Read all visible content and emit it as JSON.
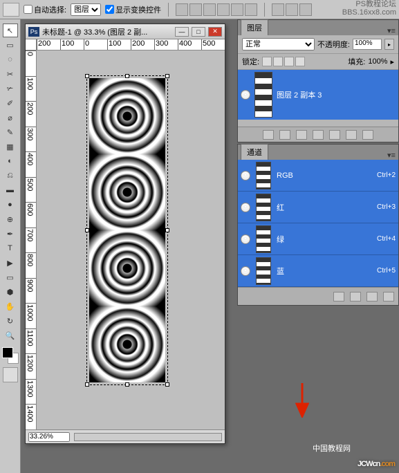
{
  "options": {
    "auto_select_label": "自动选择:",
    "auto_select_value": "图层",
    "show_transform_label": "显示变换控件"
  },
  "doc": {
    "title": "未标题-1 @ 33.3% (图层 2 副...",
    "zoom": "33.26%",
    "ruler_h": [
      "200",
      "100",
      "0",
      "100",
      "200",
      "300",
      "400",
      "500"
    ],
    "ruler_v": [
      "0",
      "100",
      "200",
      "300",
      "400",
      "500",
      "600",
      "700",
      "800",
      "900",
      "1000",
      "1100",
      "1200",
      "1300",
      "1400"
    ]
  },
  "layers_panel": {
    "tab": "图层",
    "blend": "正常",
    "opacity_label": "不透明度:",
    "opacity_value": "100%",
    "lock_label": "锁定:",
    "fill_label": "填充:",
    "fill_value": "100%",
    "layer_name": "图层 2 副本 3"
  },
  "channels_panel": {
    "tab": "通道",
    "channels": [
      {
        "name": "RGB",
        "shortcut": "Ctrl+2"
      },
      {
        "name": "红",
        "shortcut": "Ctrl+3"
      },
      {
        "name": "绿",
        "shortcut": "Ctrl+4"
      },
      {
        "name": "蓝",
        "shortcut": "Ctrl+5"
      }
    ]
  },
  "watermark": {
    "top1": "PS教程论坛",
    "top2": "BBS.16xx8.com",
    "cn": "中国教程网",
    "jcw": "JCWcn",
    "jcw2": ".com"
  },
  "tools": [
    "↖",
    "▭",
    "◌",
    "✂",
    "✎",
    "✐",
    "⌀",
    "✓",
    "▦",
    "◐",
    "⎌",
    "✏",
    "●",
    "⊕",
    "T",
    "▶",
    "▭",
    "✋",
    "🔍"
  ]
}
